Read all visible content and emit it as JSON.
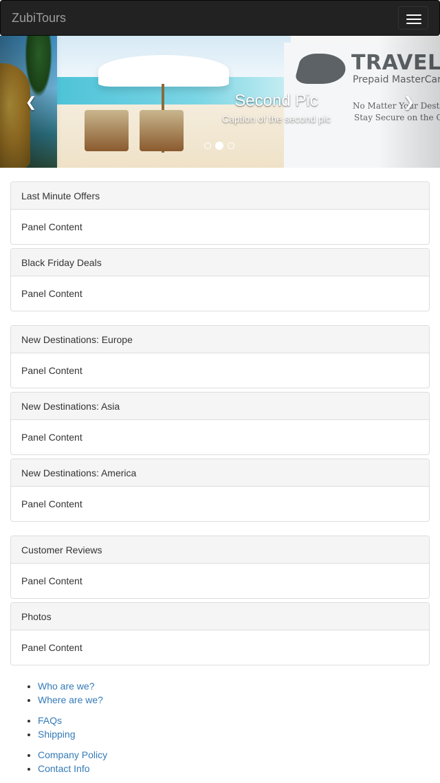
{
  "navbar": {
    "brand": "ZubiTours",
    "toggle_icon": "hamburger-icon"
  },
  "carousel": {
    "prev_icon": "chevron-left-icon",
    "next_icon": "chevron-right-icon",
    "caption_title": "Second Pic",
    "caption_text": "Caption of the second pic",
    "indicator_count": 3,
    "active_indicator": 2,
    "banner": {
      "title": "TRAVELEF",
      "subtitle": "Prepaid MasterCar",
      "line1": "No Matter Your Destination,",
      "line2": "Stay Secure on the Go"
    }
  },
  "panels": [
    {
      "heading": "Last Minute Offers",
      "body": "Panel Content"
    },
    {
      "heading": "Black Friday Deals",
      "body": "Panel Content"
    },
    {
      "heading": "New Destinations: Europe",
      "body": "Panel Content"
    },
    {
      "heading": "New Destinations: Asia",
      "body": "Panel Content"
    },
    {
      "heading": "New Destinations: America",
      "body": "Panel Content"
    },
    {
      "heading": "Customer Reviews",
      "body": "Panel Content"
    },
    {
      "heading": "Photos",
      "body": "Panel Content"
    }
  ],
  "footer": {
    "groups": [
      [
        "Who are we?",
        "Where are we?"
      ],
      [
        "FAQs",
        "Shipping"
      ],
      [
        "Company Policy",
        "Contact Info"
      ]
    ]
  },
  "colors": {
    "navbar_bg": "#222222",
    "brand_text": "#9d9d9d",
    "panel_heading_bg": "#f5f5f5",
    "panel_border": "#dddddd",
    "link": "#337ab7"
  }
}
